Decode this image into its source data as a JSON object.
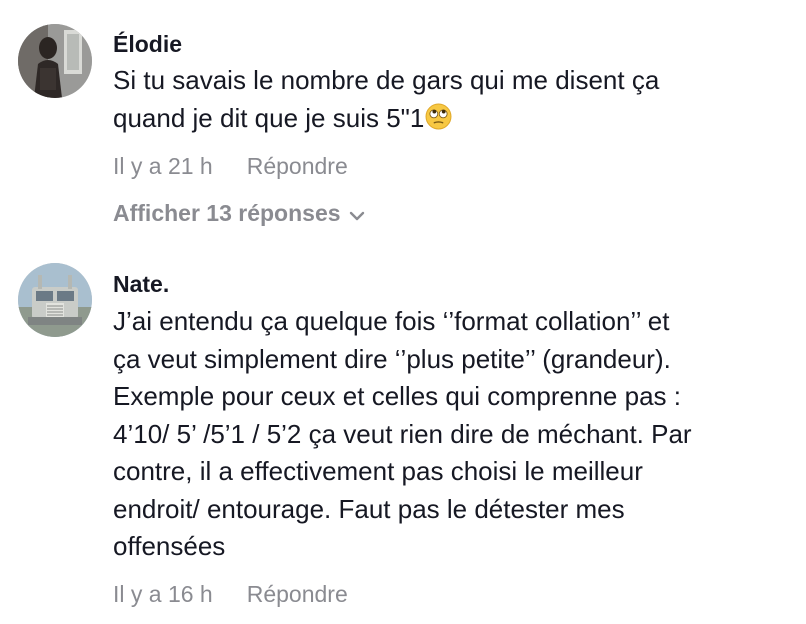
{
  "comments": [
    {
      "username": "Élodie",
      "text": "Si tu savais le nombre de gars qui me disent ça\nquand je dit que je suis 5\"1",
      "emoji": "face-with-rolling-eyes-icon",
      "time": "Il y a 21 h",
      "reply_label": "Répondre",
      "view_replies": "Afficher 13 réponses"
    },
    {
      "username": "Nate.",
      "text": "J’ai entendu ça quelque fois ‘’format collation’’ et\nça veut simplement dire ‘’plus petite’’ (grandeur).\nExemple pour ceux et celles qui comprenne pas :\n4’10/ 5’ /5’1 / 5’2 ça veut rien dire de méchant. Par\ncontre, il a effectivement pas choisi le meilleur\nendroit/ entourage. Faut pas le détester mes\noffensées",
      "time": "Il y a 16 h",
      "reply_label": "Répondre"
    }
  ],
  "colors": {
    "text": "#161823",
    "secondary": "#8a8b91"
  }
}
